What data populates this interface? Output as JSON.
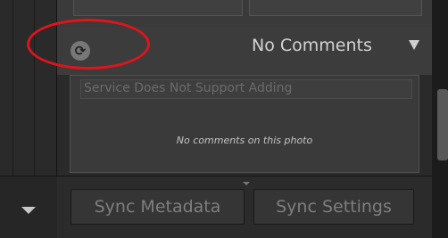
{
  "comments_panel": {
    "title": "No Comments",
    "add_placeholder": "Service Does Not Support Adding",
    "empty_message": "No comments on this photo"
  },
  "toolbar": {
    "sync_metadata": "Sync Metadata",
    "sync_settings": "Sync Settings"
  },
  "icons": {
    "refresh": "refresh-icon",
    "collapse": "triangle-down-icon",
    "left_panel_toggle": "triangle-down-icon"
  },
  "colors": {
    "highlight": "#e0141b",
    "panel": "#3c3c3c",
    "text": "#d3d3d3"
  }
}
